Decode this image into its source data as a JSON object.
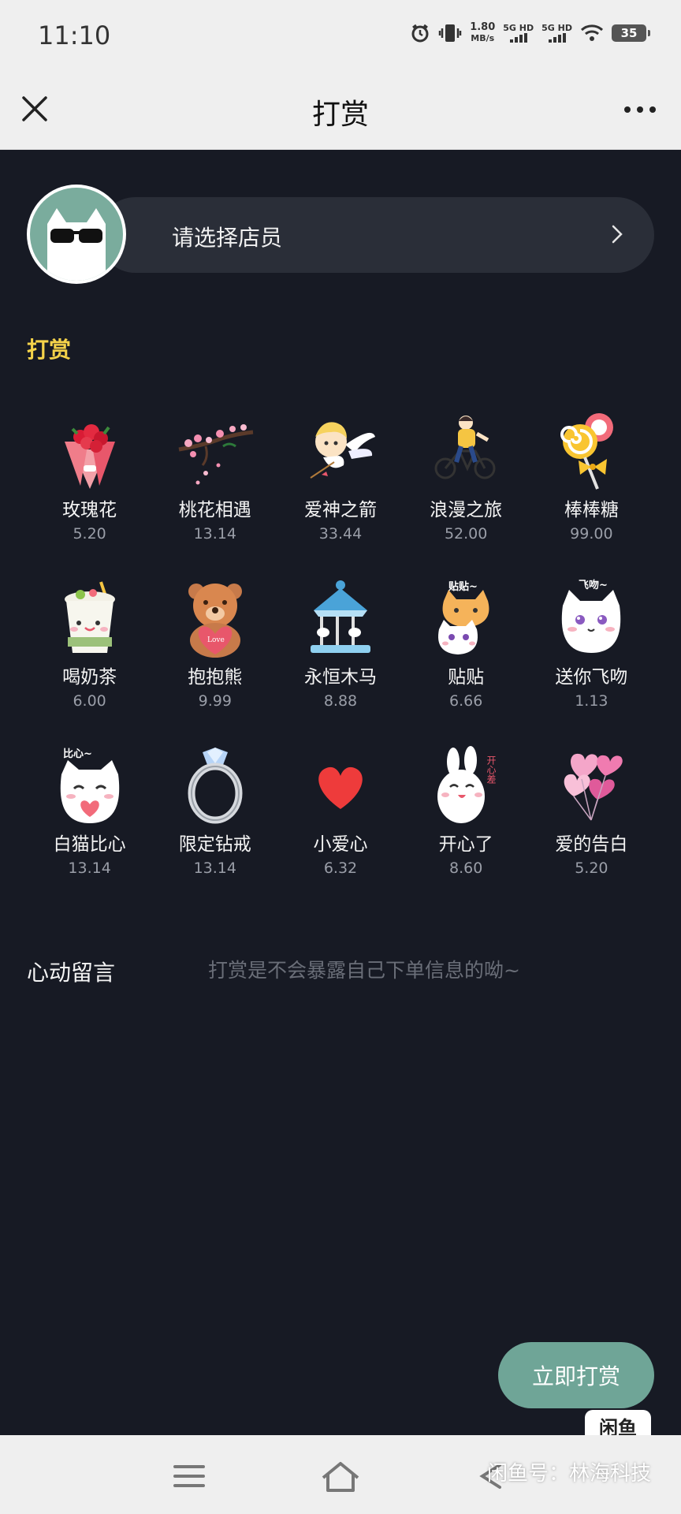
{
  "status_bar": {
    "time": "11:10",
    "speed_value": "1.80",
    "speed_unit": "MB/s",
    "sim1": "5G HD",
    "sim2": "5G HD",
    "battery": "35"
  },
  "header": {
    "title": "打赏",
    "icons": {
      "close": "close-icon",
      "more": "more-dots-icon"
    }
  },
  "staff": {
    "placeholder": "请选择店员",
    "icon": "chevron-right-icon"
  },
  "section": {
    "title": "打赏"
  },
  "gifts": [
    {
      "name": "玫瑰花",
      "price": "5.20",
      "icon": "rose-bouquet-icon"
    },
    {
      "name": "桃花相遇",
      "price": "13.14",
      "icon": "peach-blossom-icon"
    },
    {
      "name": "爱神之箭",
      "price": "33.44",
      "icon": "cupid-icon"
    },
    {
      "name": "浪漫之旅",
      "price": "52.00",
      "icon": "bicycle-trip-icon"
    },
    {
      "name": "棒棒糖",
      "price": "99.00",
      "icon": "lollipop-icon"
    },
    {
      "name": "喝奶茶",
      "price": "6.00",
      "icon": "milk-tea-icon"
    },
    {
      "name": "抱抱熊",
      "price": "9.99",
      "icon": "teddy-bear-icon"
    },
    {
      "name": "永恒木马",
      "price": "8.88",
      "icon": "carousel-icon"
    },
    {
      "name": "贴贴",
      "price": "6.66",
      "icon": "cats-cuddle-icon"
    },
    {
      "name": "送你飞吻",
      "price": "1.13",
      "icon": "kiss-cat-icon"
    },
    {
      "name": "白猫比心",
      "price": "13.14",
      "icon": "heart-cat-icon"
    },
    {
      "name": "限定钻戒",
      "price": "13.14",
      "icon": "diamond-ring-icon"
    },
    {
      "name": "小爱心",
      "price": "6.32",
      "icon": "small-heart-icon"
    },
    {
      "name": "开心了",
      "price": "8.60",
      "icon": "happy-bunny-icon"
    },
    {
      "name": "爱的告白",
      "price": "5.20",
      "icon": "heart-balloons-icon"
    }
  ],
  "gift_labels": {
    "pic_text_1": "贴贴~",
    "pic_text_2": "飞吻~",
    "pic_text_3": "比心~",
    "pic_text_4": "开心差",
    "pic_text_5": "Love"
  },
  "message": {
    "label": "心动留言",
    "placeholder": "打赏是不会暴露自己下单信息的呦~"
  },
  "submit": {
    "label": "立即打赏"
  },
  "watermark": {
    "logo": "闲鱼",
    "text": "闲鱼号：林海科技"
  },
  "nav": {
    "icons": [
      "menu-icon",
      "home-icon",
      "back-icon"
    ]
  },
  "colors": {
    "background": "#171a24",
    "accent": "#6fa597",
    "section_title": "#f5d34a",
    "pill": "#2a2e38"
  }
}
